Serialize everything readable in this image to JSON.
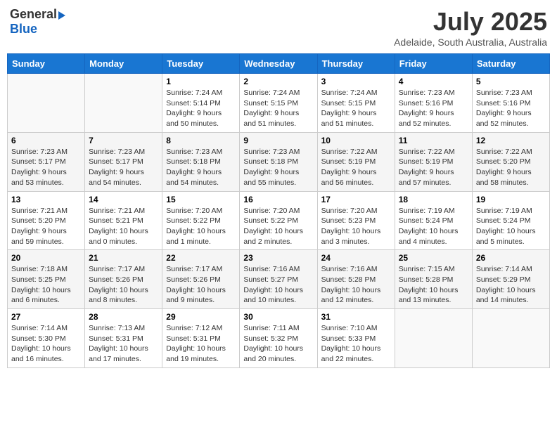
{
  "header": {
    "logo_general": "General",
    "logo_blue": "Blue",
    "month_title": "July 2025",
    "subtitle": "Adelaide, South Australia, Australia"
  },
  "calendar": {
    "days_of_week": [
      "Sunday",
      "Monday",
      "Tuesday",
      "Wednesday",
      "Thursday",
      "Friday",
      "Saturday"
    ],
    "weeks": [
      [
        {
          "day": "",
          "info": ""
        },
        {
          "day": "",
          "info": ""
        },
        {
          "day": "1",
          "info": "Sunrise: 7:24 AM\nSunset: 5:14 PM\nDaylight: 9 hours and 50 minutes."
        },
        {
          "day": "2",
          "info": "Sunrise: 7:24 AM\nSunset: 5:15 PM\nDaylight: 9 hours and 51 minutes."
        },
        {
          "day": "3",
          "info": "Sunrise: 7:24 AM\nSunset: 5:15 PM\nDaylight: 9 hours and 51 minutes."
        },
        {
          "day": "4",
          "info": "Sunrise: 7:23 AM\nSunset: 5:16 PM\nDaylight: 9 hours and 52 minutes."
        },
        {
          "day": "5",
          "info": "Sunrise: 7:23 AM\nSunset: 5:16 PM\nDaylight: 9 hours and 52 minutes."
        }
      ],
      [
        {
          "day": "6",
          "info": "Sunrise: 7:23 AM\nSunset: 5:17 PM\nDaylight: 9 hours and 53 minutes."
        },
        {
          "day": "7",
          "info": "Sunrise: 7:23 AM\nSunset: 5:17 PM\nDaylight: 9 hours and 54 minutes."
        },
        {
          "day": "8",
          "info": "Sunrise: 7:23 AM\nSunset: 5:18 PM\nDaylight: 9 hours and 54 minutes."
        },
        {
          "day": "9",
          "info": "Sunrise: 7:23 AM\nSunset: 5:18 PM\nDaylight: 9 hours and 55 minutes."
        },
        {
          "day": "10",
          "info": "Sunrise: 7:22 AM\nSunset: 5:19 PM\nDaylight: 9 hours and 56 minutes."
        },
        {
          "day": "11",
          "info": "Sunrise: 7:22 AM\nSunset: 5:19 PM\nDaylight: 9 hours and 57 minutes."
        },
        {
          "day": "12",
          "info": "Sunrise: 7:22 AM\nSunset: 5:20 PM\nDaylight: 9 hours and 58 minutes."
        }
      ],
      [
        {
          "day": "13",
          "info": "Sunrise: 7:21 AM\nSunset: 5:20 PM\nDaylight: 9 hours and 59 minutes."
        },
        {
          "day": "14",
          "info": "Sunrise: 7:21 AM\nSunset: 5:21 PM\nDaylight: 10 hours and 0 minutes."
        },
        {
          "day": "15",
          "info": "Sunrise: 7:20 AM\nSunset: 5:22 PM\nDaylight: 10 hours and 1 minute."
        },
        {
          "day": "16",
          "info": "Sunrise: 7:20 AM\nSunset: 5:22 PM\nDaylight: 10 hours and 2 minutes."
        },
        {
          "day": "17",
          "info": "Sunrise: 7:20 AM\nSunset: 5:23 PM\nDaylight: 10 hours and 3 minutes."
        },
        {
          "day": "18",
          "info": "Sunrise: 7:19 AM\nSunset: 5:24 PM\nDaylight: 10 hours and 4 minutes."
        },
        {
          "day": "19",
          "info": "Sunrise: 7:19 AM\nSunset: 5:24 PM\nDaylight: 10 hours and 5 minutes."
        }
      ],
      [
        {
          "day": "20",
          "info": "Sunrise: 7:18 AM\nSunset: 5:25 PM\nDaylight: 10 hours and 6 minutes."
        },
        {
          "day": "21",
          "info": "Sunrise: 7:17 AM\nSunset: 5:26 PM\nDaylight: 10 hours and 8 minutes."
        },
        {
          "day": "22",
          "info": "Sunrise: 7:17 AM\nSunset: 5:26 PM\nDaylight: 10 hours and 9 minutes."
        },
        {
          "day": "23",
          "info": "Sunrise: 7:16 AM\nSunset: 5:27 PM\nDaylight: 10 hours and 10 minutes."
        },
        {
          "day": "24",
          "info": "Sunrise: 7:16 AM\nSunset: 5:28 PM\nDaylight: 10 hours and 12 minutes."
        },
        {
          "day": "25",
          "info": "Sunrise: 7:15 AM\nSunset: 5:28 PM\nDaylight: 10 hours and 13 minutes."
        },
        {
          "day": "26",
          "info": "Sunrise: 7:14 AM\nSunset: 5:29 PM\nDaylight: 10 hours and 14 minutes."
        }
      ],
      [
        {
          "day": "27",
          "info": "Sunrise: 7:14 AM\nSunset: 5:30 PM\nDaylight: 10 hours and 16 minutes."
        },
        {
          "day": "28",
          "info": "Sunrise: 7:13 AM\nSunset: 5:31 PM\nDaylight: 10 hours and 17 minutes."
        },
        {
          "day": "29",
          "info": "Sunrise: 7:12 AM\nSunset: 5:31 PM\nDaylight: 10 hours and 19 minutes."
        },
        {
          "day": "30",
          "info": "Sunrise: 7:11 AM\nSunset: 5:32 PM\nDaylight: 10 hours and 20 minutes."
        },
        {
          "day": "31",
          "info": "Sunrise: 7:10 AM\nSunset: 5:33 PM\nDaylight: 10 hours and 22 minutes."
        },
        {
          "day": "",
          "info": ""
        },
        {
          "day": "",
          "info": ""
        }
      ]
    ]
  }
}
